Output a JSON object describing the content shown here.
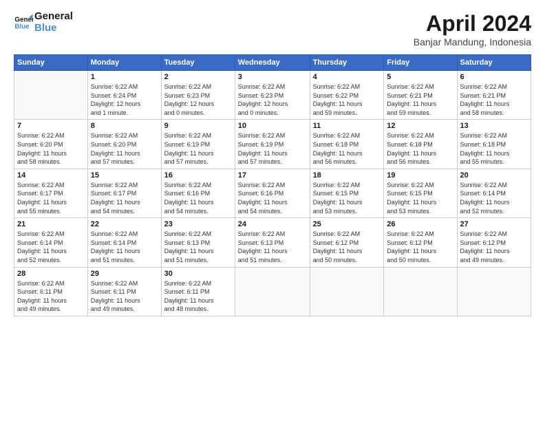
{
  "header": {
    "logo_line1": "General",
    "logo_line2": "Blue",
    "month_year": "April 2024",
    "location": "Banjar Mandung, Indonesia"
  },
  "weekdays": [
    "Sunday",
    "Monday",
    "Tuesday",
    "Wednesday",
    "Thursday",
    "Friday",
    "Saturday"
  ],
  "weeks": [
    [
      {
        "day": "",
        "info": ""
      },
      {
        "day": "1",
        "info": "Sunrise: 6:22 AM\nSunset: 6:24 PM\nDaylight: 12 hours\nand 1 minute."
      },
      {
        "day": "2",
        "info": "Sunrise: 6:22 AM\nSunset: 6:23 PM\nDaylight: 12 hours\nand 0 minutes."
      },
      {
        "day": "3",
        "info": "Sunrise: 6:22 AM\nSunset: 6:23 PM\nDaylight: 12 hours\nand 0 minutes."
      },
      {
        "day": "4",
        "info": "Sunrise: 6:22 AM\nSunset: 6:22 PM\nDaylight: 11 hours\nand 59 minutes."
      },
      {
        "day": "5",
        "info": "Sunrise: 6:22 AM\nSunset: 6:21 PM\nDaylight: 11 hours\nand 59 minutes."
      },
      {
        "day": "6",
        "info": "Sunrise: 6:22 AM\nSunset: 6:21 PM\nDaylight: 11 hours\nand 58 minutes."
      }
    ],
    [
      {
        "day": "7",
        "info": "Sunrise: 6:22 AM\nSunset: 6:20 PM\nDaylight: 11 hours\nand 58 minutes."
      },
      {
        "day": "8",
        "info": "Sunrise: 6:22 AM\nSunset: 6:20 PM\nDaylight: 11 hours\nand 57 minutes."
      },
      {
        "day": "9",
        "info": "Sunrise: 6:22 AM\nSunset: 6:19 PM\nDaylight: 11 hours\nand 57 minutes."
      },
      {
        "day": "10",
        "info": "Sunrise: 6:22 AM\nSunset: 6:19 PM\nDaylight: 11 hours\nand 57 minutes."
      },
      {
        "day": "11",
        "info": "Sunrise: 6:22 AM\nSunset: 6:18 PM\nDaylight: 11 hours\nand 56 minutes."
      },
      {
        "day": "12",
        "info": "Sunrise: 6:22 AM\nSunset: 6:18 PM\nDaylight: 11 hours\nand 56 minutes."
      },
      {
        "day": "13",
        "info": "Sunrise: 6:22 AM\nSunset: 6:18 PM\nDaylight: 11 hours\nand 55 minutes."
      }
    ],
    [
      {
        "day": "14",
        "info": "Sunrise: 6:22 AM\nSunset: 6:17 PM\nDaylight: 11 hours\nand 55 minutes."
      },
      {
        "day": "15",
        "info": "Sunrise: 6:22 AM\nSunset: 6:17 PM\nDaylight: 11 hours\nand 54 minutes."
      },
      {
        "day": "16",
        "info": "Sunrise: 6:22 AM\nSunset: 6:16 PM\nDaylight: 11 hours\nand 54 minutes."
      },
      {
        "day": "17",
        "info": "Sunrise: 6:22 AM\nSunset: 6:16 PM\nDaylight: 11 hours\nand 54 minutes."
      },
      {
        "day": "18",
        "info": "Sunrise: 6:22 AM\nSunset: 6:15 PM\nDaylight: 11 hours\nand 53 minutes."
      },
      {
        "day": "19",
        "info": "Sunrise: 6:22 AM\nSunset: 6:15 PM\nDaylight: 11 hours\nand 53 minutes."
      },
      {
        "day": "20",
        "info": "Sunrise: 6:22 AM\nSunset: 6:14 PM\nDaylight: 11 hours\nand 52 minutes."
      }
    ],
    [
      {
        "day": "21",
        "info": "Sunrise: 6:22 AM\nSunset: 6:14 PM\nDaylight: 11 hours\nand 52 minutes."
      },
      {
        "day": "22",
        "info": "Sunrise: 6:22 AM\nSunset: 6:14 PM\nDaylight: 11 hours\nand 51 minutes."
      },
      {
        "day": "23",
        "info": "Sunrise: 6:22 AM\nSunset: 6:13 PM\nDaylight: 11 hours\nand 51 minutes."
      },
      {
        "day": "24",
        "info": "Sunrise: 6:22 AM\nSunset: 6:13 PM\nDaylight: 11 hours\nand 51 minutes."
      },
      {
        "day": "25",
        "info": "Sunrise: 6:22 AM\nSunset: 6:12 PM\nDaylight: 11 hours\nand 50 minutes."
      },
      {
        "day": "26",
        "info": "Sunrise: 6:22 AM\nSunset: 6:12 PM\nDaylight: 11 hours\nand 50 minutes."
      },
      {
        "day": "27",
        "info": "Sunrise: 6:22 AM\nSunset: 6:12 PM\nDaylight: 11 hours\nand 49 minutes."
      }
    ],
    [
      {
        "day": "28",
        "info": "Sunrise: 6:22 AM\nSunset: 6:11 PM\nDaylight: 11 hours\nand 49 minutes."
      },
      {
        "day": "29",
        "info": "Sunrise: 6:22 AM\nSunset: 6:11 PM\nDaylight: 11 hours\nand 49 minutes."
      },
      {
        "day": "30",
        "info": "Sunrise: 6:22 AM\nSunset: 6:11 PM\nDaylight: 11 hours\nand 48 minutes."
      },
      {
        "day": "",
        "info": ""
      },
      {
        "day": "",
        "info": ""
      },
      {
        "day": "",
        "info": ""
      },
      {
        "day": "",
        "info": ""
      }
    ]
  ]
}
